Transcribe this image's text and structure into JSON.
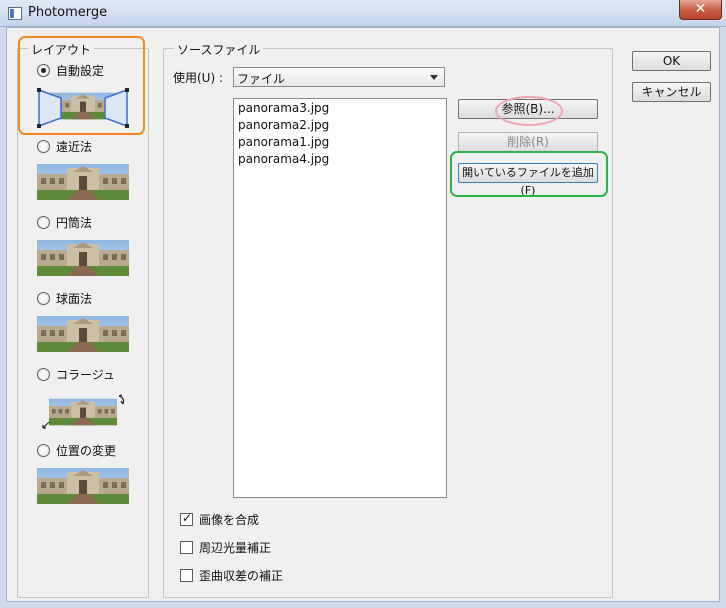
{
  "window": {
    "title": "Photomerge",
    "close_glyph": "✕"
  },
  "layout_group": {
    "legend": "レイアウト",
    "options": [
      {
        "label": "自動設定",
        "checked": true
      },
      {
        "label": "遠近法",
        "checked": false
      },
      {
        "label": "円筒法",
        "checked": false
      },
      {
        "label": "球面法",
        "checked": false
      },
      {
        "label": "コラージュ",
        "checked": false
      },
      {
        "label": "位置の変更",
        "checked": false
      }
    ]
  },
  "source_group": {
    "legend": "ソースファイル",
    "use_label": "使用(U) :",
    "use_value": "ファイル",
    "files": [
      "panorama3.jpg",
      "panorama2.jpg",
      "panorama1.jpg",
      "panorama4.jpg"
    ],
    "browse_button": "参照(B)...",
    "remove_button": "削除(R)",
    "add_open_button": "開いているファイルを追加(F)"
  },
  "options": {
    "blend_images": {
      "label": "画像を合成",
      "checked": true
    },
    "vignette_removal": {
      "label": "周辺光量補正",
      "checked": false
    },
    "distortion_correction": {
      "label": "歪曲収差の補正",
      "checked": false
    }
  },
  "actions": {
    "ok": "OK",
    "cancel": "キャンセル"
  },
  "icons": [
    "app-icon",
    "close-icon",
    "dropdown-arrow-icon",
    "rotate-icon",
    "resize-icon"
  ],
  "colors": {
    "orange_highlight": "#f08a24",
    "green_highlight": "#2eb04b",
    "pink_highlight": "#f3a3b3"
  }
}
